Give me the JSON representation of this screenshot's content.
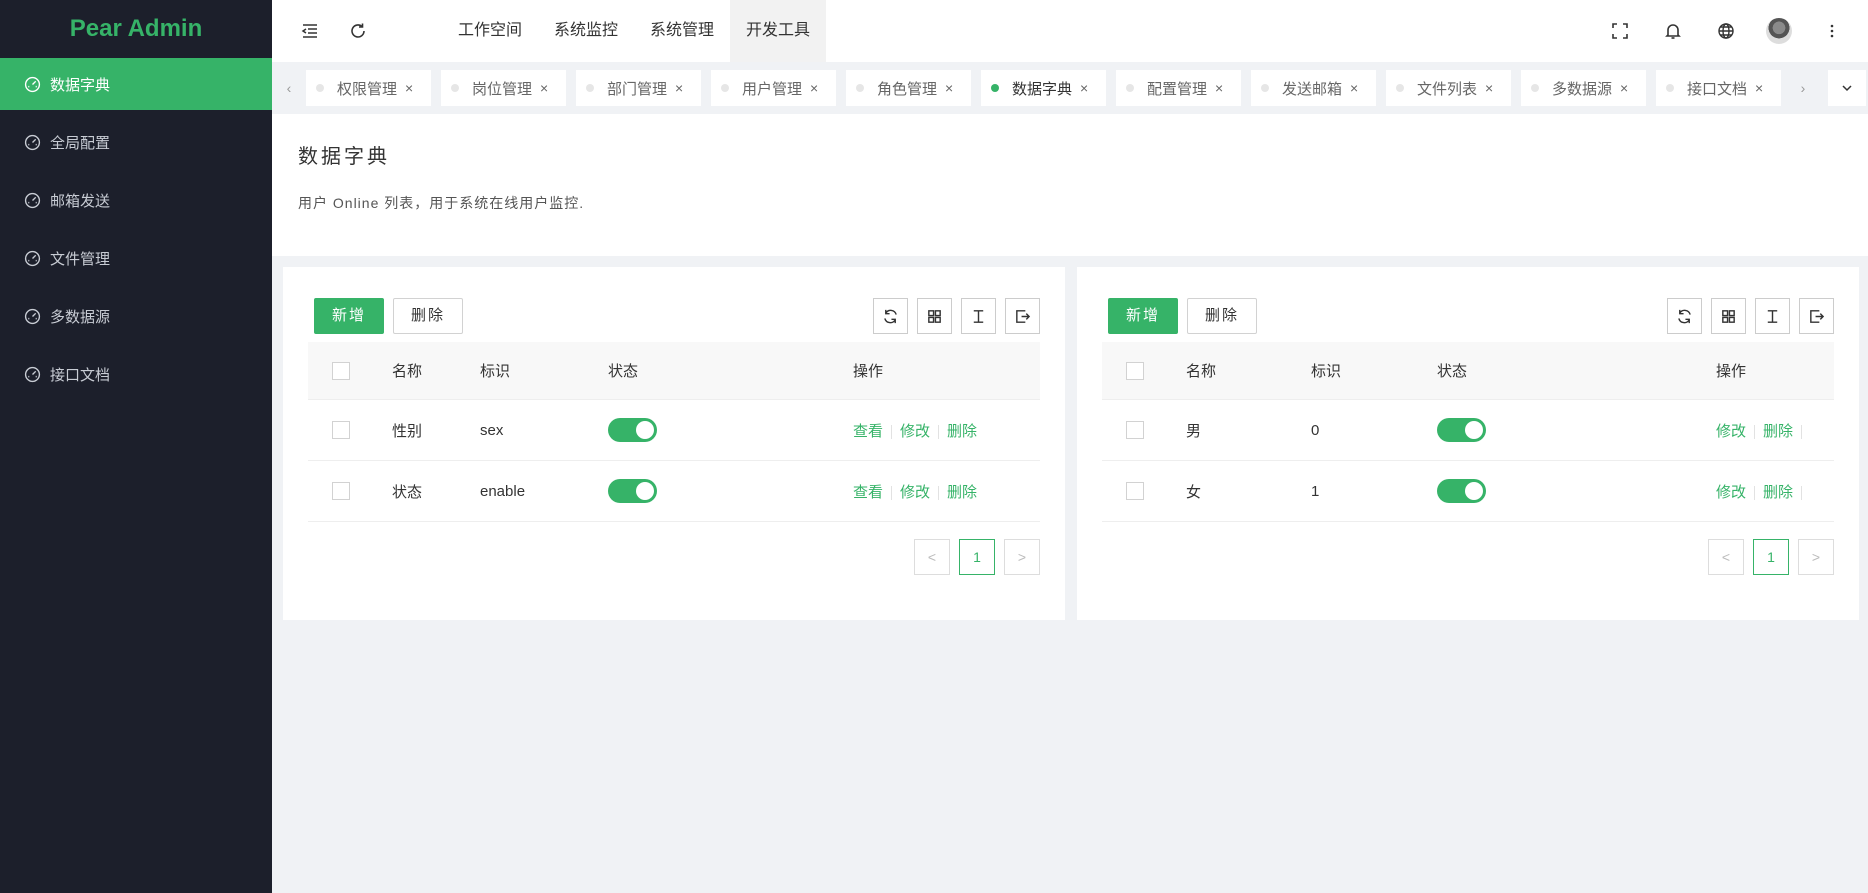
{
  "app": {
    "name": "Pear Admin"
  },
  "sidebar": {
    "items": [
      {
        "label": "数据字典",
        "icon": "gauge-icon",
        "active": true
      },
      {
        "label": "全局配置",
        "icon": "gauge-icon"
      },
      {
        "label": "邮箱发送",
        "icon": "gauge-icon"
      },
      {
        "label": "文件管理",
        "icon": "gauge-icon"
      },
      {
        "label": "多数据源",
        "icon": "gauge-icon"
      },
      {
        "label": "接口文档",
        "icon": "gauge-icon"
      }
    ]
  },
  "header": {
    "nav": [
      "工作空间",
      "系统监控",
      "系统管理",
      "开发工具"
    ],
    "active_nav": "开发工具",
    "icons": [
      "menu-fold-icon",
      "refresh-icon",
      "fullscreen-icon",
      "bell-icon",
      "globe-icon",
      "avatar",
      "more-vertical-icon"
    ]
  },
  "tabs": {
    "items": [
      "权限管理",
      "岗位管理",
      "部门管理",
      "用户管理",
      "角色管理",
      "数据字典",
      "配置管理",
      "发送邮箱",
      "文件列表",
      "多数据源",
      "接口文档"
    ],
    "active": "数据字典",
    "close_glyph": "×",
    "prev_glyph": "‹",
    "next_glyph": "›",
    "dropdown_glyph": "⌄"
  },
  "page": {
    "title": "数据字典",
    "description": "用户 Online 列表，用于系统在线用户监控."
  },
  "left_table": {
    "add_label": "新增",
    "delete_label": "删除",
    "columns": [
      "名称",
      "标识",
      "状态",
      "操作"
    ],
    "rows": [
      {
        "name": "性别",
        "key": "sex",
        "enabled": true,
        "actions": [
          "查看",
          "修改",
          "删除"
        ]
      },
      {
        "name": "状态",
        "key": "enable",
        "enabled": true,
        "actions": [
          "查看",
          "修改",
          "删除"
        ]
      }
    ],
    "pagination": {
      "prev": "<",
      "page": "1",
      "next": ">"
    }
  },
  "right_table": {
    "add_label": "新增",
    "delete_label": "删除",
    "columns": [
      "名称",
      "标识",
      "状态",
      "操作"
    ],
    "rows": [
      {
        "name": "男",
        "key": "0",
        "enabled": true,
        "actions": [
          "修改",
          "删除"
        ]
      },
      {
        "name": "女",
        "key": "1",
        "enabled": true,
        "actions": [
          "修改",
          "删除"
        ]
      }
    ],
    "pagination": {
      "prev": "<",
      "page": "1",
      "next": ">"
    }
  },
  "colors": {
    "accent": "#36b368",
    "sidebar_bg": "#1c1f2b",
    "page_bg": "#f0f2f5"
  }
}
